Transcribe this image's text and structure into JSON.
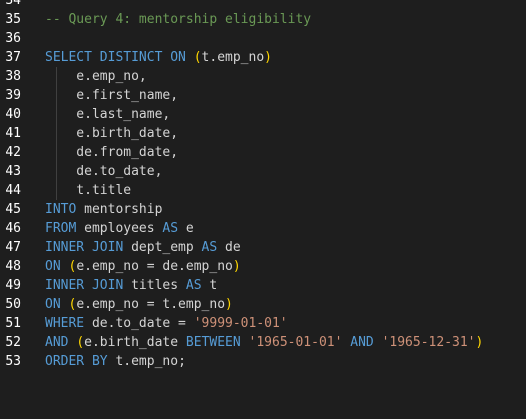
{
  "editor": {
    "colors": {
      "background": "#1e1e1e",
      "line_number": "#ffffff",
      "text": "#d4d4d4",
      "keyword": "#569cd6",
      "string": "#ce9178",
      "comment": "#6a9955",
      "bracket": "#ffd700"
    },
    "lines": [
      {
        "num": "34",
        "tokens": []
      },
      {
        "num": "35",
        "tokens": [
          {
            "t": "cm",
            "v": "-- Query 4: mentorship eligibility"
          }
        ]
      },
      {
        "num": "36",
        "tokens": []
      },
      {
        "num": "37",
        "tokens": [
          {
            "t": "kw",
            "v": "SELECT DISTINCT ON "
          },
          {
            "t": "paren",
            "v": "("
          },
          {
            "t": "tx",
            "v": "t.emp_no"
          },
          {
            "t": "paren",
            "v": ")"
          }
        ]
      },
      {
        "num": "38",
        "guide": true,
        "tokens": [
          {
            "t": "tx",
            "v": "    e.emp_no,"
          }
        ]
      },
      {
        "num": "39",
        "guide": true,
        "tokens": [
          {
            "t": "tx",
            "v": "    e.first_name,"
          }
        ]
      },
      {
        "num": "40",
        "guide": true,
        "tokens": [
          {
            "t": "tx",
            "v": "    e.last_name,"
          }
        ]
      },
      {
        "num": "41",
        "guide": true,
        "tokens": [
          {
            "t": "tx",
            "v": "    e.birth_date,"
          }
        ]
      },
      {
        "num": "42",
        "guide": true,
        "tokens": [
          {
            "t": "tx",
            "v": "    de.from_date,"
          }
        ]
      },
      {
        "num": "43",
        "guide": true,
        "tokens": [
          {
            "t": "tx",
            "v": "    de.to_date,"
          }
        ]
      },
      {
        "num": "44",
        "guide": true,
        "tokens": [
          {
            "t": "tx",
            "v": "    t.title"
          }
        ]
      },
      {
        "num": "45",
        "tokens": [
          {
            "t": "kw",
            "v": "INTO "
          },
          {
            "t": "tx",
            "v": "mentorship"
          }
        ]
      },
      {
        "num": "46",
        "tokens": [
          {
            "t": "kw",
            "v": "FROM "
          },
          {
            "t": "tx",
            "v": "employees "
          },
          {
            "t": "kw",
            "v": "AS "
          },
          {
            "t": "tx",
            "v": "e"
          }
        ]
      },
      {
        "num": "47",
        "tokens": [
          {
            "t": "kw",
            "v": "INNER JOIN "
          },
          {
            "t": "tx",
            "v": "dept_emp "
          },
          {
            "t": "kw",
            "v": "AS "
          },
          {
            "t": "tx",
            "v": "de"
          }
        ]
      },
      {
        "num": "48",
        "tokens": [
          {
            "t": "kw",
            "v": "ON "
          },
          {
            "t": "paren",
            "v": "("
          },
          {
            "t": "tx",
            "v": "e.emp_no = de.emp_no"
          },
          {
            "t": "paren",
            "v": ")"
          }
        ]
      },
      {
        "num": "49",
        "tokens": [
          {
            "t": "kw",
            "v": "INNER JOIN "
          },
          {
            "t": "tx",
            "v": "titles "
          },
          {
            "t": "kw",
            "v": "AS "
          },
          {
            "t": "tx",
            "v": "t"
          }
        ]
      },
      {
        "num": "50",
        "tokens": [
          {
            "t": "kw",
            "v": "ON "
          },
          {
            "t": "paren",
            "v": "("
          },
          {
            "t": "tx",
            "v": "e.emp_no = t.emp_no"
          },
          {
            "t": "paren",
            "v": ")"
          }
        ]
      },
      {
        "num": "51",
        "tokens": [
          {
            "t": "kw",
            "v": "WHERE "
          },
          {
            "t": "tx",
            "v": "de.to_date = "
          },
          {
            "t": "str",
            "v": "'9999-01-01'"
          }
        ]
      },
      {
        "num": "52",
        "tokens": [
          {
            "t": "kw",
            "v": "AND "
          },
          {
            "t": "paren",
            "v": "("
          },
          {
            "t": "tx",
            "v": "e.birth_date "
          },
          {
            "t": "kw",
            "v": "BETWEEN "
          },
          {
            "t": "str",
            "v": "'1965-01-01'"
          },
          {
            "t": "tx",
            "v": " "
          },
          {
            "t": "kw",
            "v": "AND "
          },
          {
            "t": "str",
            "v": "'1965-12-31'"
          },
          {
            "t": "paren",
            "v": ")"
          }
        ]
      },
      {
        "num": "53",
        "tokens": [
          {
            "t": "kw",
            "v": "ORDER BY "
          },
          {
            "t": "tx",
            "v": "t.emp_no;"
          }
        ]
      }
    ]
  }
}
